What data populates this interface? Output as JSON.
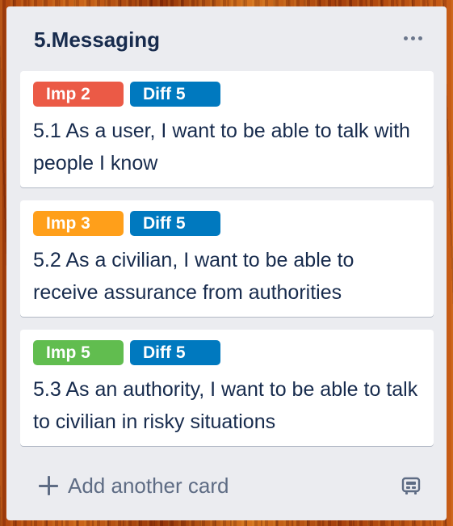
{
  "list": {
    "title": "5.Messaging",
    "menu_icon": "more-horizontal-icon",
    "cards": [
      {
        "labels": [
          {
            "text": "Imp 2",
            "color": "#eb5a46"
          },
          {
            "text": "Diff 5",
            "color": "#0079bf"
          }
        ],
        "title": "5.1 As a user, I want to be able to talk with people I know"
      },
      {
        "labels": [
          {
            "text": "Imp 3",
            "color": "#ff9f1a"
          },
          {
            "text": "Diff 5",
            "color": "#0079bf"
          }
        ],
        "title": "5.2 As a civilian, I want to be able to receive assurance from authorities"
      },
      {
        "labels": [
          {
            "text": "Imp 5",
            "color": "#61bd4f"
          },
          {
            "text": "Diff 5",
            "color": "#0079bf"
          }
        ],
        "title": "5.3 As an authority, I want to be able to talk to civilian in risky situations"
      }
    ],
    "add_card_label": "Add another card",
    "add_icon": "plus-icon",
    "template_icon": "card-template-icon"
  },
  "colors": {
    "list_bg": "#ebecf0",
    "text": "#172b4d",
    "muted": "#5e6c84"
  }
}
